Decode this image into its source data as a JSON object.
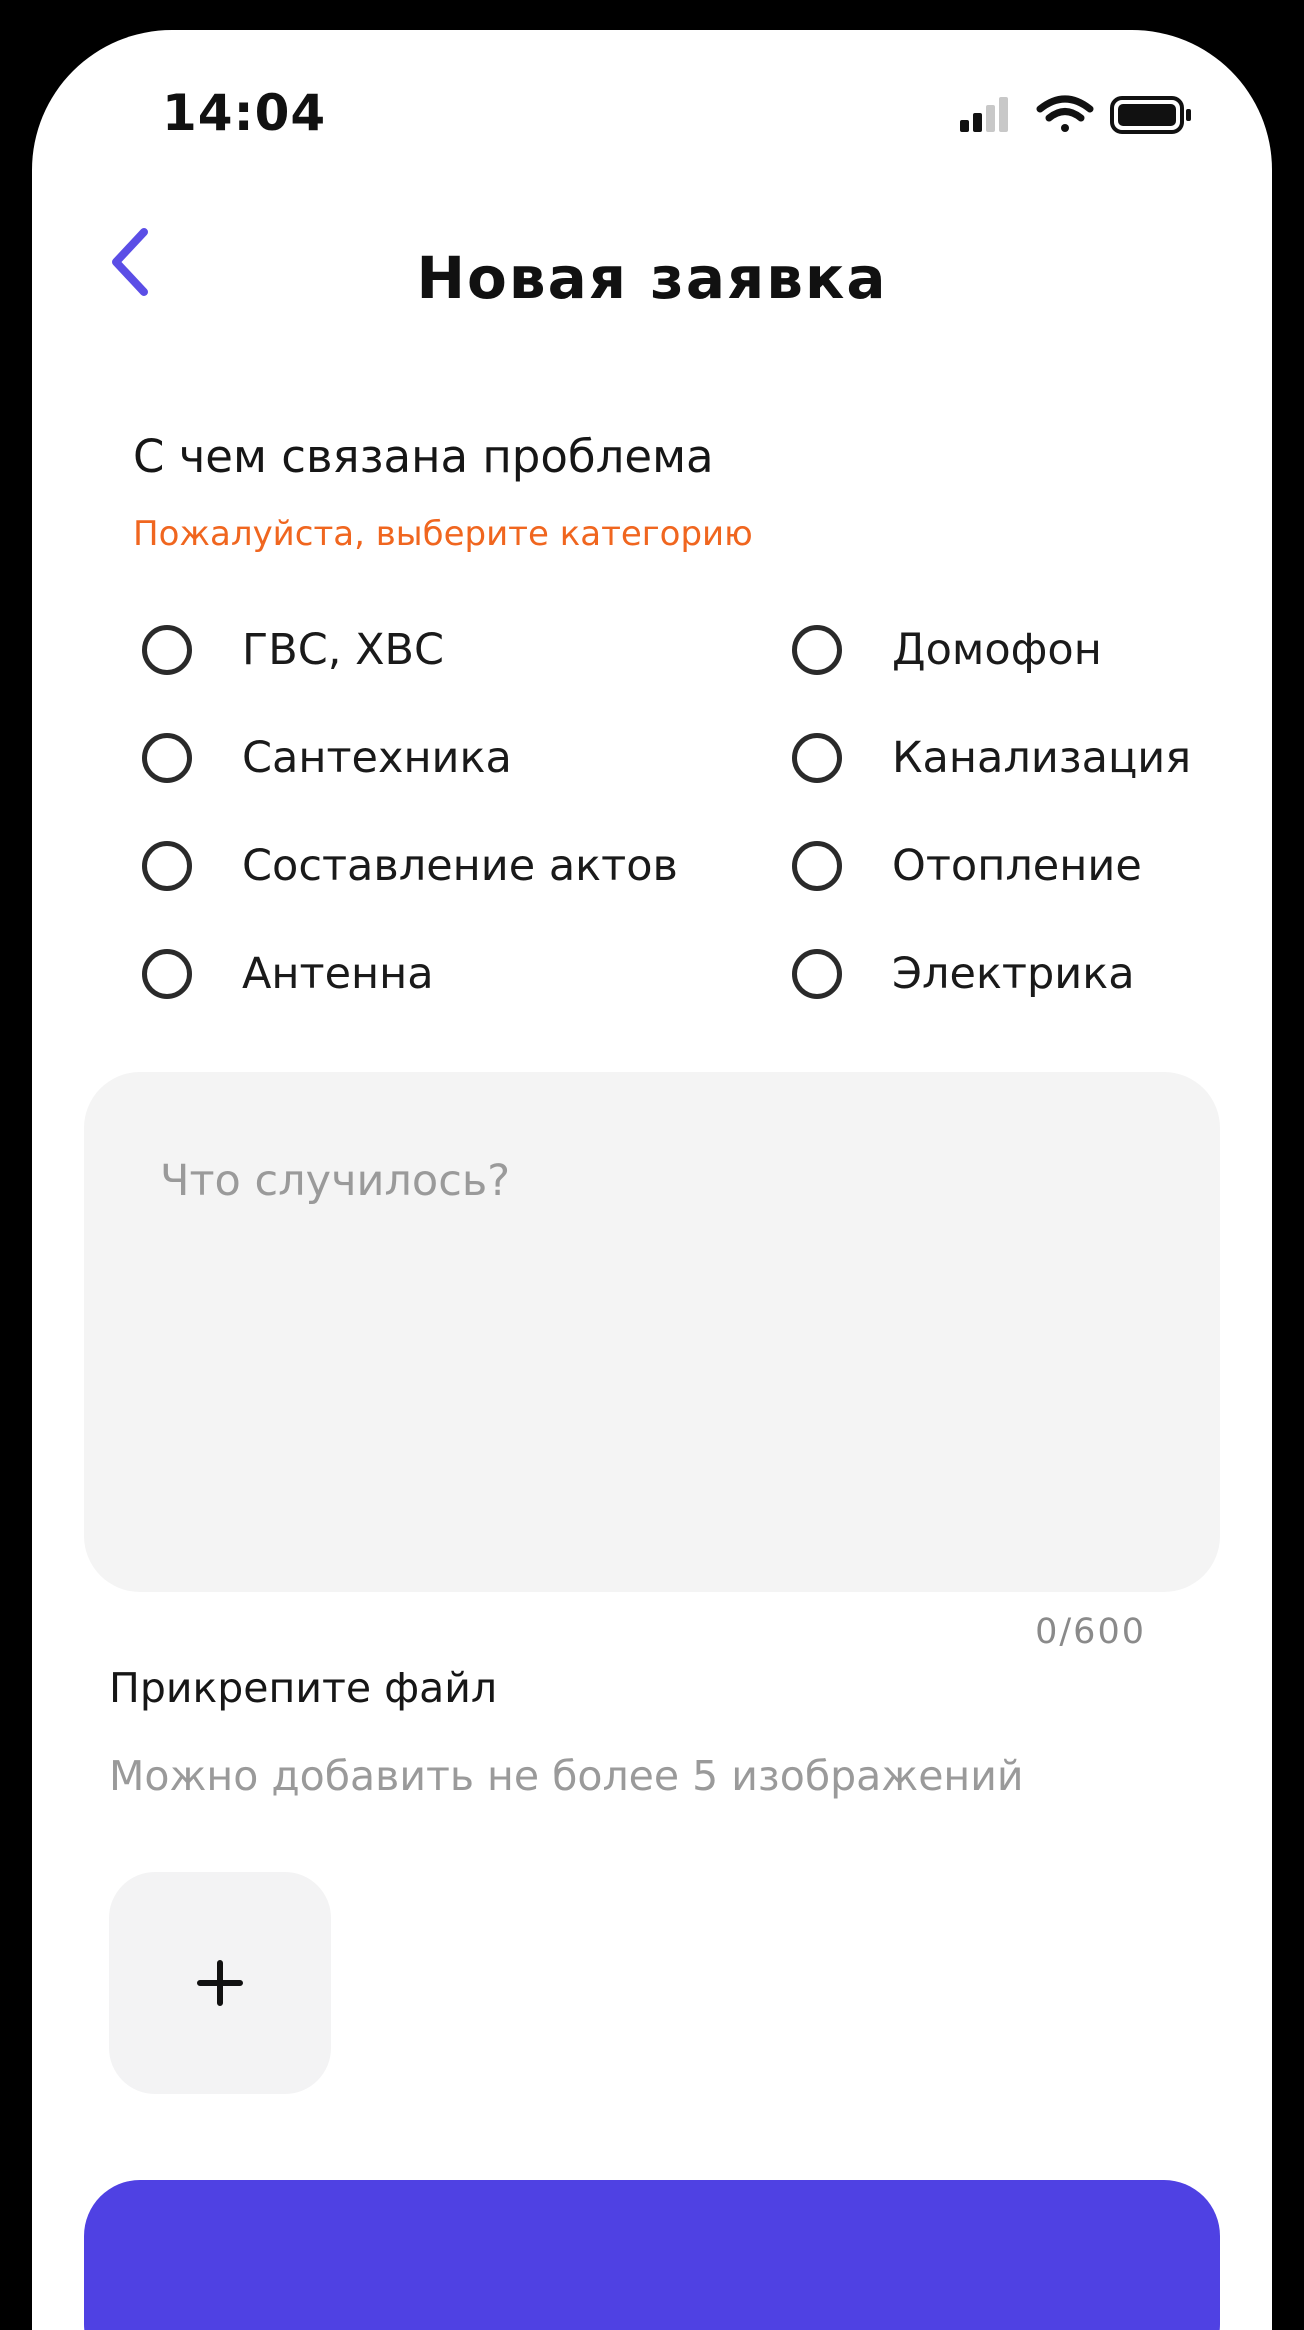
{
  "status_bar": {
    "time": "14:04",
    "icons": [
      "cellular-signal-icon",
      "wifi-icon",
      "battery-icon"
    ]
  },
  "header": {
    "back_icon": "chevron-left-icon",
    "title": "Новая заявка"
  },
  "category": {
    "heading": "С чем связана проблема",
    "hint": "Пожалуйста, выберите категорию",
    "options": [
      {
        "label": "ГВС, ХВС",
        "selected": false
      },
      {
        "label": "Домофон",
        "selected": false
      },
      {
        "label": "Сантехника",
        "selected": false
      },
      {
        "label": "Канализация",
        "selected": false
      },
      {
        "label": "Составление актов",
        "selected": false
      },
      {
        "label": "Отопление",
        "selected": false
      },
      {
        "label": "Антенна",
        "selected": false
      },
      {
        "label": "Электрика",
        "selected": false
      }
    ]
  },
  "description": {
    "placeholder": "Что случилось?",
    "value": "",
    "counter": "0/600"
  },
  "attachments": {
    "heading": "Прикрепите файл",
    "hint": "Можно добавить не более 5 изображений",
    "add_icon": "plus-icon"
  },
  "submit": {
    "label": ""
  },
  "colors": {
    "accent": "#4f41e3",
    "back_chevron": "#5b4ee6",
    "hint_orange": "#f0661f",
    "field_background": "#f4f4f4",
    "placeholder_gray": "#9a9a9a"
  }
}
